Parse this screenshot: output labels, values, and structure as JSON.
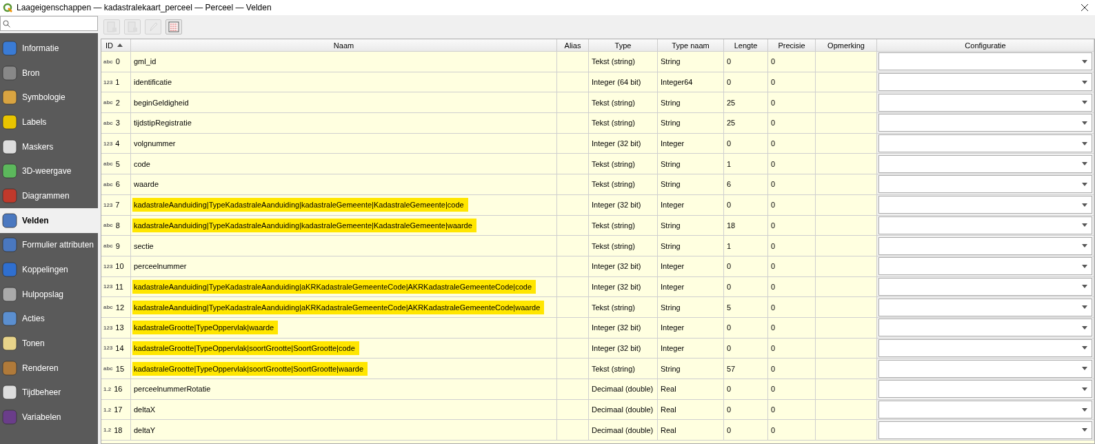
{
  "window": {
    "title": "Laageigenschappen — kadastralekaart_perceel — Perceel — Velden"
  },
  "sidebar": {
    "items": [
      {
        "label": "Informatie",
        "selected": false
      },
      {
        "label": "Bron",
        "selected": false
      },
      {
        "label": "Symbologie",
        "selected": false
      },
      {
        "label": "Labels",
        "selected": false
      },
      {
        "label": "Maskers",
        "selected": false
      },
      {
        "label": "3D-weergave",
        "selected": false
      },
      {
        "label": "Diagrammen",
        "selected": false
      },
      {
        "label": "Velden",
        "selected": true
      },
      {
        "label": "Formulier attributen",
        "selected": false
      },
      {
        "label": "Koppelingen",
        "selected": false
      },
      {
        "label": "Hulpopslag",
        "selected": false
      },
      {
        "label": "Acties",
        "selected": false
      },
      {
        "label": "Tonen",
        "selected": false
      },
      {
        "label": "Renderen",
        "selected": false
      },
      {
        "label": "Tijdbeheer",
        "selected": false
      },
      {
        "label": "Variabelen",
        "selected": false
      }
    ]
  },
  "toolbar": [
    {
      "disabled": true
    },
    {
      "disabled": true
    },
    {
      "disabled": true
    },
    {
      "disabled": false
    }
  ],
  "table": {
    "columns": [
      "ID",
      "Naam",
      "Alias",
      "Type",
      "Type naam",
      "Lengte",
      "Precisie",
      "Opmerking",
      "Configuratie"
    ],
    "rows": [
      {
        "type_icon": "abc",
        "id": "0",
        "name": "gml_id",
        "type": "Tekst (string)",
        "type_name": "String",
        "length": "0",
        "precision": "0",
        "highlighted": false
      },
      {
        "type_icon": "123",
        "id": "1",
        "name": "identificatie",
        "type": "Integer (64 bit)",
        "type_name": "Integer64",
        "length": "0",
        "precision": "0",
        "highlighted": false
      },
      {
        "type_icon": "abc",
        "id": "2",
        "name": "beginGeldigheid",
        "type": "Tekst (string)",
        "type_name": "String",
        "length": "25",
        "precision": "0",
        "highlighted": false
      },
      {
        "type_icon": "abc",
        "id": "3",
        "name": "tijdstipRegistratie",
        "type": "Tekst (string)",
        "type_name": "String",
        "length": "25",
        "precision": "0",
        "highlighted": false
      },
      {
        "type_icon": "123",
        "id": "4",
        "name": "volgnummer",
        "type": "Integer (32 bit)",
        "type_name": "Integer",
        "length": "0",
        "precision": "0",
        "highlighted": false
      },
      {
        "type_icon": "abc",
        "id": "5",
        "name": "code",
        "type": "Tekst (string)",
        "type_name": "String",
        "length": "1",
        "precision": "0",
        "highlighted": false
      },
      {
        "type_icon": "abc",
        "id": "6",
        "name": "waarde",
        "type": "Tekst (string)",
        "type_name": "String",
        "length": "6",
        "precision": "0",
        "highlighted": false
      },
      {
        "type_icon": "123",
        "id": "7",
        "name": "kadastraleAanduiding|TypeKadastraleAanduiding|kadastraleGemeente|KadastraleGemeente|code",
        "type": "Integer (32 bit)",
        "type_name": "Integer",
        "length": "0",
        "precision": "0",
        "highlighted": true
      },
      {
        "type_icon": "abc",
        "id": "8",
        "name": "kadastraleAanduiding|TypeKadastraleAanduiding|kadastraleGemeente|KadastraleGemeente|waarde",
        "type": "Tekst (string)",
        "type_name": "String",
        "length": "18",
        "precision": "0",
        "highlighted": true
      },
      {
        "type_icon": "abc",
        "id": "9",
        "name": "sectie",
        "type": "Tekst (string)",
        "type_name": "String",
        "length": "1",
        "precision": "0",
        "highlighted": false
      },
      {
        "type_icon": "123",
        "id": "10",
        "name": "perceelnummer",
        "type": "Integer (32 bit)",
        "type_name": "Integer",
        "length": "0",
        "precision": "0",
        "highlighted": false
      },
      {
        "type_icon": "123",
        "id": "11",
        "name": "kadastraleAanduiding|TypeKadastraleAanduiding|aKRKadastraleGemeenteCode|AKRKadastraleGemeenteCode|code",
        "type": "Integer (32 bit)",
        "type_name": "Integer",
        "length": "0",
        "precision": "0",
        "highlighted": true
      },
      {
        "type_icon": "abc",
        "id": "12",
        "name": "kadastraleAanduiding|TypeKadastraleAanduiding|aKRKadastraleGemeenteCode|AKRKadastraleGemeenteCode|waarde",
        "type": "Tekst (string)",
        "type_name": "String",
        "length": "5",
        "precision": "0",
        "highlighted": true
      },
      {
        "type_icon": "123",
        "id": "13",
        "name": "kadastraleGrootte|TypeOppervlak|waarde",
        "type": "Integer (32 bit)",
        "type_name": "Integer",
        "length": "0",
        "precision": "0",
        "highlighted": true
      },
      {
        "type_icon": "123",
        "id": "14",
        "name": "kadastraleGrootte|TypeOppervlak|soortGrootte|SoortGrootte|code",
        "type": "Integer (32 bit)",
        "type_name": "Integer",
        "length": "0",
        "precision": "0",
        "highlighted": true
      },
      {
        "type_icon": "abc",
        "id": "15",
        "name": "kadastraleGrootte|TypeOppervlak|soortGrootte|SoortGrootte|waarde",
        "type": "Tekst (string)",
        "type_name": "String",
        "length": "57",
        "precision": "0",
        "highlighted": true
      },
      {
        "type_icon": "1.2",
        "id": "16",
        "name": "perceelnummerRotatie",
        "type": "Decimaal (double)",
        "type_name": "Real",
        "length": "0",
        "precision": "0",
        "highlighted": false
      },
      {
        "type_icon": "1.2",
        "id": "17",
        "name": "deltaX",
        "type": "Decimaal (double)",
        "type_name": "Real",
        "length": "0",
        "precision": "0",
        "highlighted": false
      },
      {
        "type_icon": "1.2",
        "id": "18",
        "name": "deltaY",
        "type": "Decimaal (double)",
        "type_name": "Real",
        "length": "0",
        "precision": "0",
        "highlighted": false
      }
    ]
  }
}
